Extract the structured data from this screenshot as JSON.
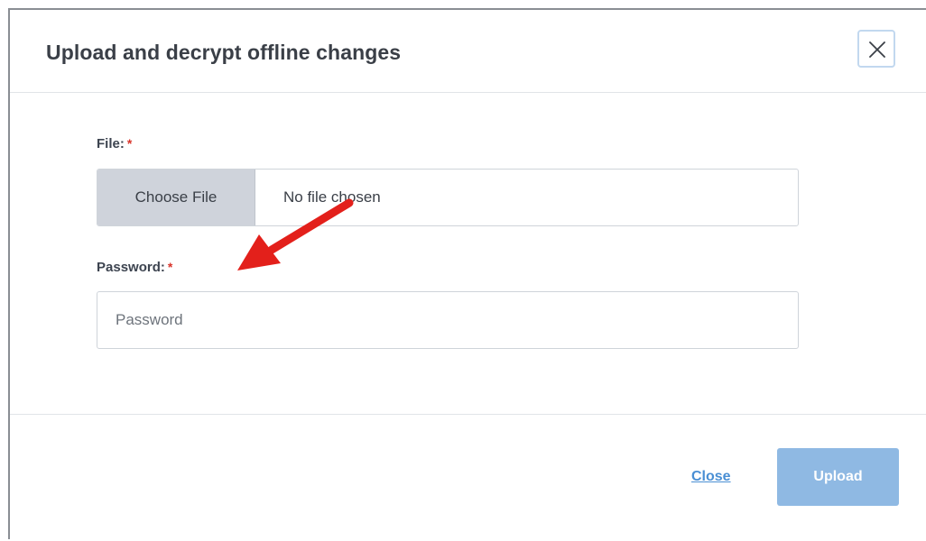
{
  "dialog": {
    "title": "Upload and decrypt offline changes",
    "close_icon": "close-icon"
  },
  "form": {
    "file": {
      "label": "File:",
      "required_mark": "*",
      "button_label": "Choose File",
      "status": "No file chosen"
    },
    "password": {
      "label": "Password:",
      "required_mark": "*",
      "placeholder": "Password",
      "value": ""
    }
  },
  "annotation": {
    "icon": "red-arrow-icon",
    "color": "#e3201b"
  },
  "footer": {
    "close_label": "Close",
    "upload_label": "Upload"
  },
  "colors": {
    "accent_link": "#4a8fd4",
    "upload_button_disabled": "#8fb9e3",
    "required": "#d9342b"
  }
}
